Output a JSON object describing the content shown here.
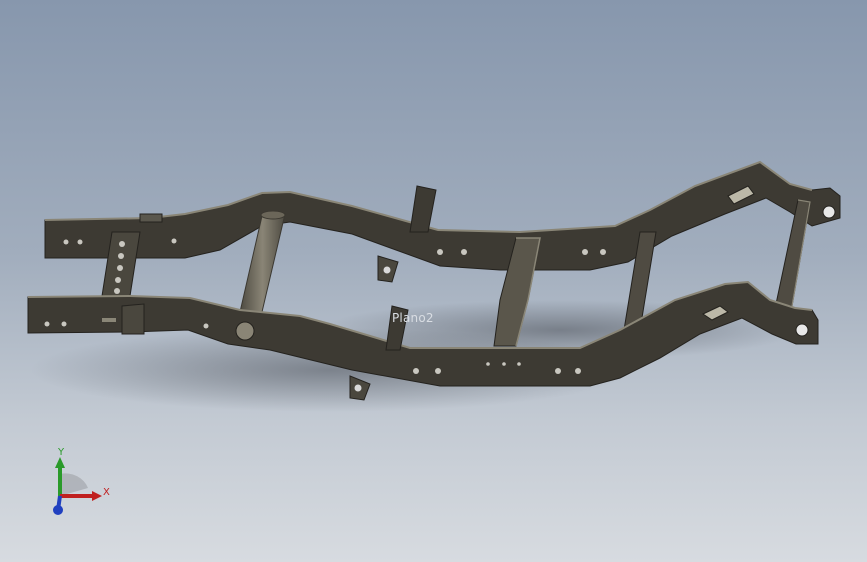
{
  "scene": {
    "model_name": "chassis-frame",
    "plane_label": "Plano2",
    "background_top": "#8797ad",
    "background_bottom": "#d7dbe0",
    "frame_color": "#3d3a33",
    "frame_highlight": "#8a8677",
    "tube_color": "#6b6659"
  },
  "triad": {
    "x_label": "X",
    "y_label": "Y",
    "x_color": "#c02020",
    "y_color": "#2a9a2a",
    "z_color": "#2040c0"
  }
}
